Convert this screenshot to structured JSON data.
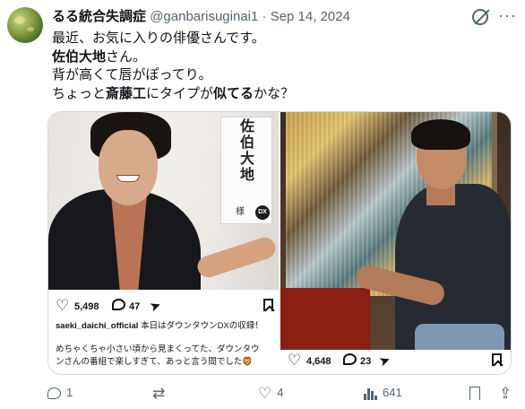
{
  "tweet": {
    "author_name": "るる統合失調症",
    "handle": "@ganbarisuginai1",
    "separator": "·",
    "date": "Sep 14, 2024",
    "text_lines": [
      {
        "parts": [
          {
            "t": "最近、お気に入りの俳優さんです。",
            "bold": false
          }
        ]
      },
      {
        "parts": [
          {
            "t": "佐伯大地",
            "bold": true
          },
          {
            "t": "さん。",
            "bold": false
          }
        ]
      },
      {
        "parts": [
          {
            "t": "背が高くて唇がぽってり。",
            "bold": false
          }
        ]
      },
      {
        "parts": [
          {
            "t": "ちょっと",
            "bold": false
          },
          {
            "t": "斎藤工",
            "bold": true
          },
          {
            "t": "にタイプが",
            "bold": false
          },
          {
            "t": "似てる",
            "bold": true
          },
          {
            "t": "かな？",
            "bold": false
          }
        ]
      }
    ]
  },
  "media": {
    "left_post": {
      "card_name": "佐伯大地",
      "card_sama": "様",
      "card_badge": "DX",
      "likes": "5,498",
      "comments": "47",
      "caption_user": "saeki_daichi_official",
      "caption_text": "本日はダウンタウンDXの収録！",
      "caption_body": [
        "めちゃくちゃ小さい頃から見まくってた、ダウンタウ",
        "ンさんの番組で楽しすぎて、あっと言う間でした🦁"
      ]
    },
    "right_post": {
      "likes": "4,648",
      "comments": "23"
    }
  },
  "footer": {
    "replies": "1",
    "retweets": "",
    "likes": "4",
    "views": "641"
  },
  "icons": {
    "grok": "grok-icon",
    "more": "more-icon",
    "reply": "reply-icon",
    "retweet": "retweet-icon",
    "like": "heart-icon",
    "views": "views-icon",
    "bookmark": "bookmark-icon",
    "share": "share-icon"
  },
  "colors": {
    "text": "#0f1419",
    "secondary": "#536471",
    "border": "#cfd9de"
  }
}
